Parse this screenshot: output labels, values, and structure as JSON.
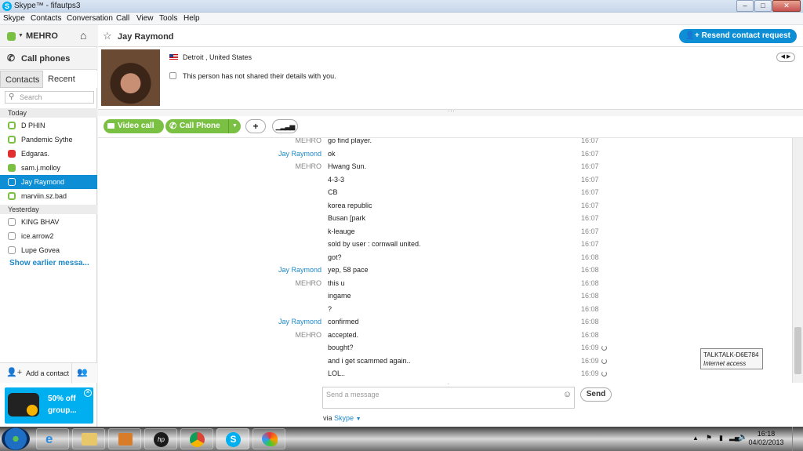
{
  "window": {
    "title": "Skype™ - fifautps3",
    "minimize": "–",
    "maximize": "□",
    "close": "✕"
  },
  "menu": [
    "Skype",
    "Contacts",
    "Conversation",
    "Call",
    "View",
    "Tools",
    "Help"
  ],
  "sidebar": {
    "profile_name": "MEHRO",
    "call_phones": "Call phones",
    "tabs": [
      "Contacts",
      "Recent"
    ],
    "search_placeholder": "Search",
    "groups": [
      {
        "label": "Today",
        "contacts": [
          {
            "name": "D PHIN",
            "status": "online-outline"
          },
          {
            "name": "Pandemic Sythe",
            "status": "online-outline"
          },
          {
            "name": "Edgaras.",
            "status": "do-not-disturb"
          },
          {
            "name": "sam.j.molloy",
            "status": "online"
          },
          {
            "name": "Jay Raymond",
            "status": "unknown",
            "selected": true
          },
          {
            "name": "marviin.sz.bad",
            "status": "online-outline"
          }
        ]
      },
      {
        "label": "Yesterday",
        "contacts": [
          {
            "name": "KING BHAV",
            "status": "unknown"
          },
          {
            "name": "ice.arrow2",
            "status": "unknown"
          },
          {
            "name": "Lupe Govea",
            "status": "unknown"
          }
        ]
      }
    ],
    "show_earlier": "Show earlier messa...",
    "add_contact": "Add a contact",
    "ad_text_1": "50% off",
    "ad_text_2": "group..."
  },
  "conversation": {
    "contact_name": "Jay Raymond",
    "resend_label": "Resend contact request",
    "location": "Detroit , United States",
    "details_note": "This person has not shared their details with you.",
    "video_call": "Video call",
    "call_phone": "Call Phone",
    "messages": [
      {
        "sender": "MEHRO",
        "text": "go find player.",
        "time": "16:07"
      },
      {
        "sender": "Jay Raymond",
        "text": "ok",
        "time": "16:07"
      },
      {
        "sender": "MEHRO",
        "text": "Hwang Sun.",
        "time": "16:07"
      },
      {
        "sender": "",
        "text": "4-3-3",
        "time": "16:07"
      },
      {
        "sender": "",
        "text": "CB",
        "time": "16:07"
      },
      {
        "sender": "",
        "text": "korea republic",
        "time": "16:07"
      },
      {
        "sender": "",
        "text": "Busan [park",
        "time": "16:07"
      },
      {
        "sender": "",
        "text": "k-leauge",
        "time": "16:07"
      },
      {
        "sender": "",
        "text": "sold by user : cornwall united.",
        "time": "16:07"
      },
      {
        "sender": "",
        "text": "got?",
        "time": "16:08"
      },
      {
        "sender": "Jay Raymond",
        "text": "yep, 58 pace",
        "time": "16:08"
      },
      {
        "sender": "MEHRO",
        "text": "this u",
        "time": "16:08"
      },
      {
        "sender": "",
        "text": "ingame",
        "time": "16:08"
      },
      {
        "sender": "",
        "text": "?",
        "time": "16:08"
      },
      {
        "sender": "Jay Raymond",
        "text": "confirmed",
        "time": "16:08"
      },
      {
        "sender": "MEHRO",
        "text": "accepted.",
        "time": "16:08"
      },
      {
        "sender": "",
        "text": "bought?",
        "time": "16:09",
        "pending": true
      },
      {
        "sender": "",
        "text": "and i get scammed again..",
        "time": "16:09",
        "pending": true
      },
      {
        "sender": "",
        "text": "LOL..",
        "time": "16:09",
        "pending": true
      }
    ],
    "input_placeholder": "Send a message",
    "send_label": "Send",
    "via_prefix": "via",
    "via_link": "Skype"
  },
  "tooltip": {
    "line1": "TALKTALK-D6E784",
    "line2": "Internet access"
  },
  "taskbar": {
    "time": "16:18",
    "date": "04/02/2013"
  },
  "colors": {
    "skype_blue": "#00aff0",
    "accent_blue": "#0e8ed4",
    "green": "#7ac143",
    "sender_blue": "#1e88c7"
  }
}
